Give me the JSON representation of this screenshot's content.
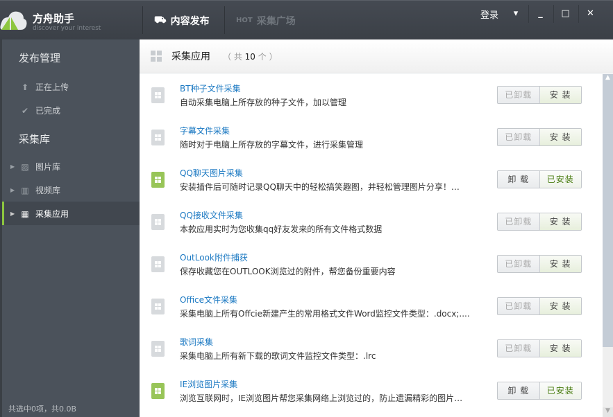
{
  "app": {
    "name": "方舟助手",
    "slogan": "discover your interest"
  },
  "nav": [
    {
      "label": "内容发布",
      "icon": "upload-tray-icon"
    },
    {
      "label": "采集广场",
      "icon": "hot-icon"
    }
  ],
  "window": {
    "login": "登录",
    "menu": "▾",
    "minimize": "_",
    "maximize": "□",
    "close": "✕"
  },
  "sidebar": {
    "section1": "发布管理",
    "publish_items": [
      {
        "label": "正在上传",
        "icon": "arrow-up-icon"
      },
      {
        "label": "已完成",
        "icon": "check-icon"
      }
    ],
    "section2": "采集库",
    "library_items": [
      {
        "label": "图片库",
        "icon": "image-icon"
      },
      {
        "label": "视频库",
        "icon": "film-icon"
      },
      {
        "label": "采集应用",
        "icon": "grid-icon"
      }
    ],
    "status": "共选中0项，共0.0B"
  },
  "main": {
    "title": "采集应用",
    "count_prefix": "（ 共",
    "count": "10",
    "count_suffix": "个 ）",
    "apps": [
      {
        "title": "BT种子文件采集",
        "desc": "自动采集电脑上所存放的种子文件，加以管理",
        "installed": false
      },
      {
        "title": "字幕文件采集",
        "desc": "随时对于电脑上所存放的字幕文件，进行采集管理",
        "installed": false
      },
      {
        "title": "QQ聊天图片采集",
        "desc": "安装插件后可随时记录QQ聊天中的轻松搞笑趣图，并轻松管理图片分享！…",
        "installed": true
      },
      {
        "title": "QQ接收文件采集",
        "desc": "本款应用实时为您收集qq好友发来的所有文件格式数据",
        "installed": false
      },
      {
        "title": "OutLook附件捕获",
        "desc": "保存收藏您在OUTLOOK浏览过的附件，帮您备份重要内容",
        "installed": false
      },
      {
        "title": "Office文件采集",
        "desc": "采集电脑上所有Offcie新建产生的常用格式文件Word监控文件类型：.docx;....",
        "installed": false
      },
      {
        "title": "歌词采集",
        "desc": "采集电脑上所有新下载的歌词文件监控文件类型：.lrc",
        "installed": false
      },
      {
        "title": "IE浏览图片采集",
        "desc": "浏览互联网时，IE浏览图片帮您采集网络上浏览过的，防止遗漏精彩的图片…",
        "installed": true
      }
    ],
    "labels": {
      "uninstalled": "已卸载",
      "install": "安 装",
      "uninstall": "卸 载",
      "installed": "已安装"
    }
  },
  "colors": {
    "accent": "#8dc63f",
    "link": "#1a78c2"
  }
}
